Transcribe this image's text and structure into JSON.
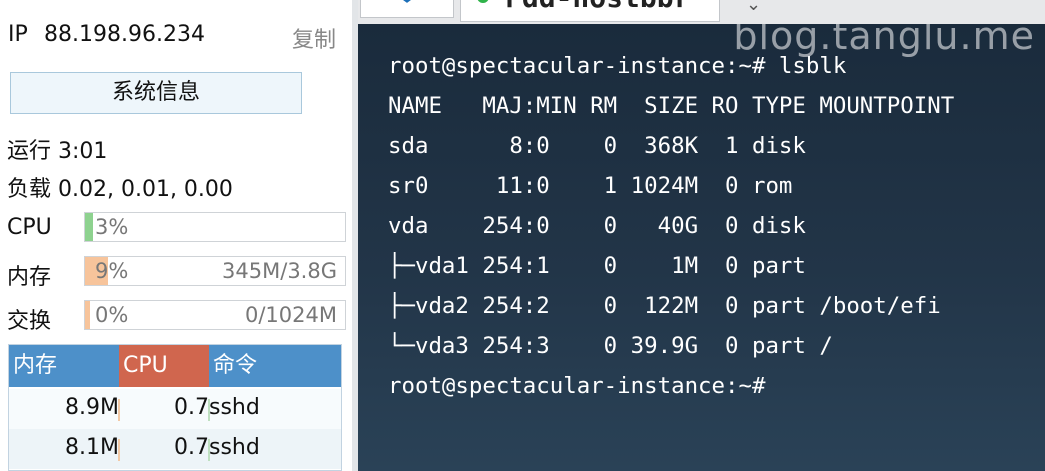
{
  "left": {
    "ip_label": "IP",
    "ip_value": "88.198.96.234",
    "copy_label": "复制",
    "sysinfo_button": "系统信息",
    "uptime": "运行 3:01",
    "load": "负载 0.02, 0.01, 0.00",
    "bars": [
      {
        "label": "CPU",
        "percent": "3%",
        "fraction": 0.03,
        "amount": "",
        "color": "#8ed28f"
      },
      {
        "label": "内存",
        "percent": "9%",
        "fraction": 0.09,
        "amount": "345M/3.8G",
        "color": "#f7c49b"
      },
      {
        "label": "交换",
        "percent": "0%",
        "fraction": 0.0,
        "amount": "0/1024M",
        "color": "#f7c49b"
      }
    ],
    "process_table": {
      "headers": [
        {
          "label": "内存",
          "color": "#4d90c9"
        },
        {
          "label": "CPU",
          "color": "#d0664e"
        },
        {
          "label": "命令",
          "color": "#4d90c9"
        }
      ],
      "rows": [
        {
          "mem": "8.9M",
          "cpu": "0.7",
          "cmd": "sshd"
        },
        {
          "mem": "8.1M",
          "cpu": "0.7",
          "cmd": "sshd"
        }
      ]
    }
  },
  "terminal": {
    "tab_title": "Fdd-hostbbr",
    "watermark": "blog.tanglu.me",
    "lines": [
      "root@spectacular-instance:~# lsblk",
      "NAME   MAJ:MIN RM  SIZE RO TYPE MOUNTPOINT",
      "sda      8:0    0  368K  1 disk",
      "sr0     11:0    1 1024M  0 rom",
      "vda    254:0    0   40G  0 disk",
      "├─vda1 254:1    0    1M  0 part",
      "├─vda2 254:2    0  122M  0 part /boot/efi",
      "└─vda3 254:3    0 39.9G  0 part /",
      "root@spectacular-instance:~#"
    ]
  }
}
